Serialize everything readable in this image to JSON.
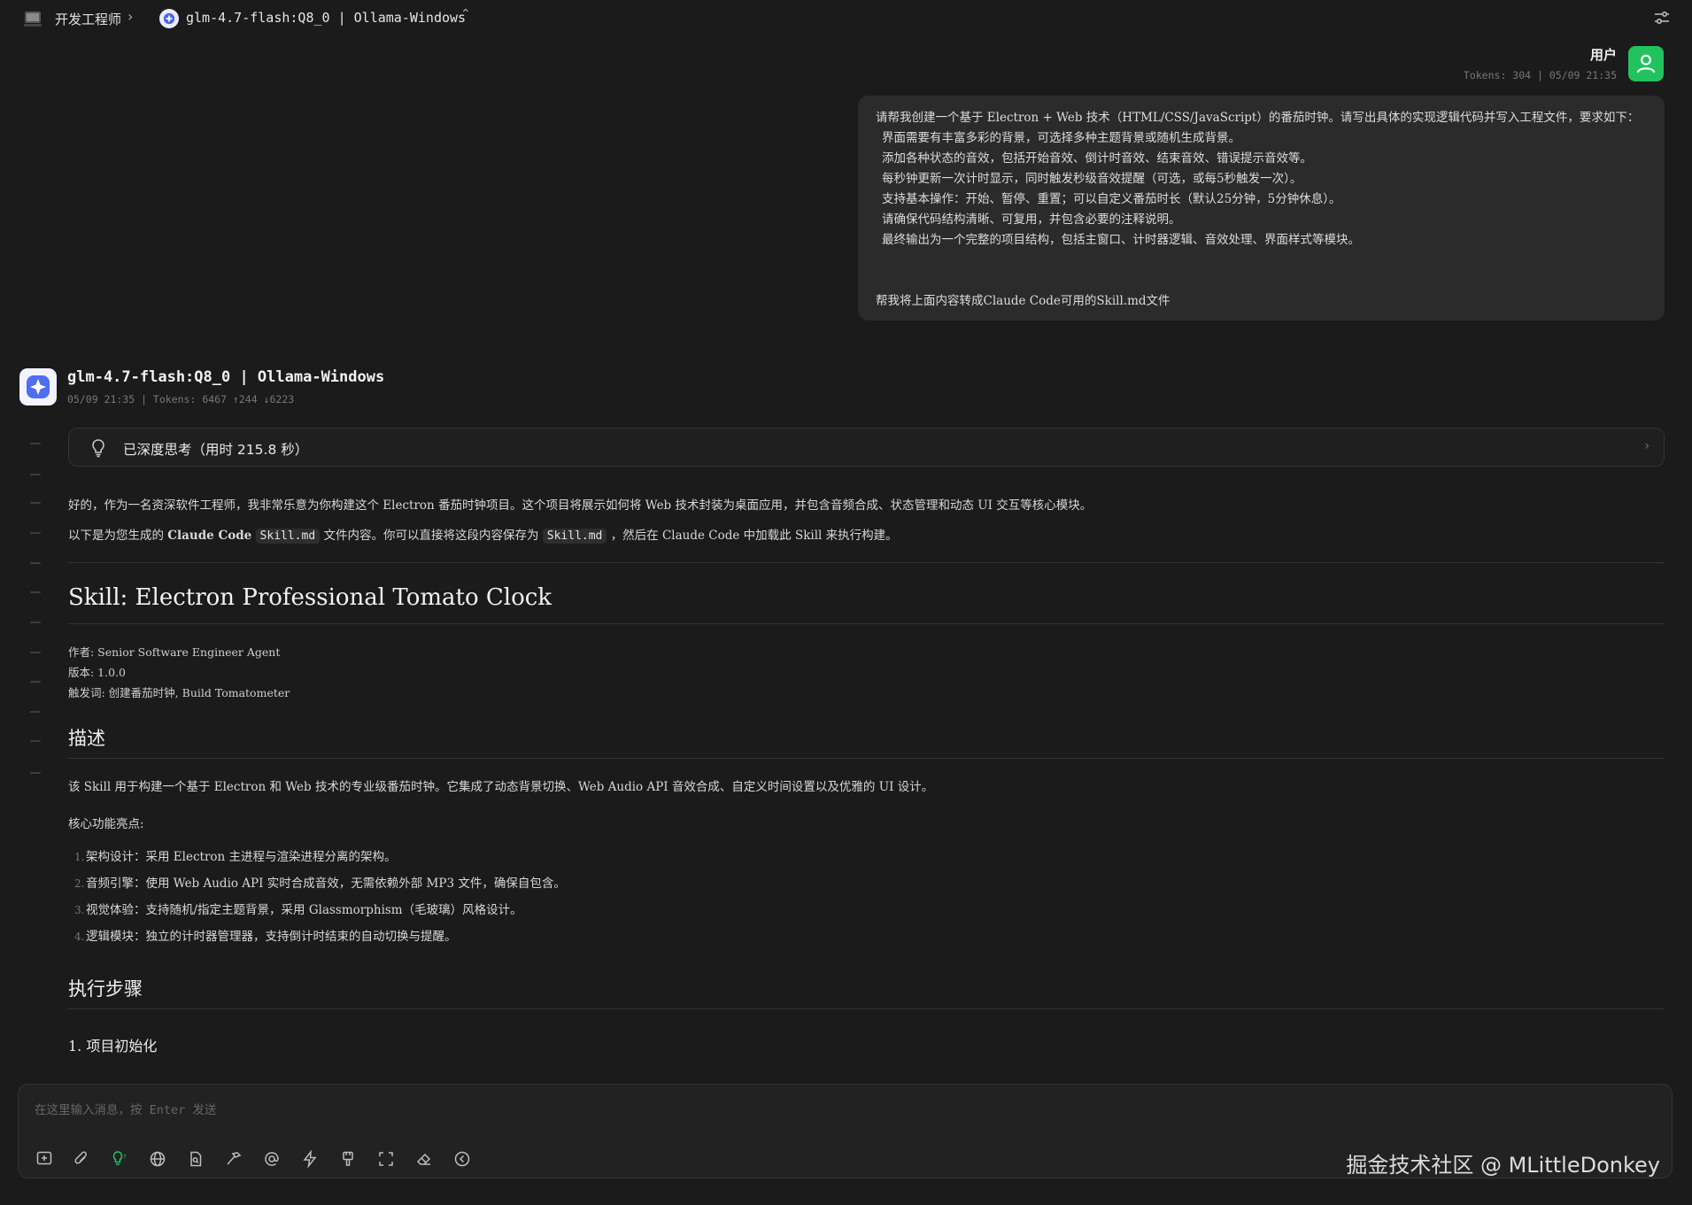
{
  "topbar": {
    "workspace": "开发工程师",
    "model": "glm-4.7-flash:Q8_0 | Ollama-Windows"
  },
  "user_message": {
    "name": "用户",
    "meta": "Tokens: 304 | 05/09 21:35",
    "lines": [
      "请帮我创建一个基于 Electron + Web 技术（HTML/CSS/JavaScript）的番茄时钟。请写出具体的实现逻辑代码并写入工程文件，要求如下：",
      "界面需要有丰富多彩的背景，可选择多种主题背景或随机生成背景。",
      "添加各种状态的音效，包括开始音效、倒计时音效、结束音效、错误提示音效等。",
      "每秒钟更新一次计时显示，同时触发秒级音效提醒（可选，或每5秒触发一次）。",
      "支持基本操作：开始、暂停、重置；可以自定义番茄时长（默认25分钟，5分钟休息）。",
      "请确保代码结构清晰、可复用，并包含必要的注释说明。",
      "最终输出为一个完整的项目结构，包括主窗口、计时器逻辑、音效处理、界面样式等模块。"
    ],
    "last_line": "帮我将上面内容转成Claude Code可用的Skill.md文件"
  },
  "assistant": {
    "name": "glm-4.7-flash:Q8_0 | Ollama-Windows",
    "meta": "05/09 21:35 | Tokens: 6467 ↑244 ↓6223",
    "thinking": "已深度思考（用时 215.8 秒）",
    "intro": "好的，作为一名资深软件工程师，我非常乐意为你构建这个 Electron 番茄时钟项目。这个项目将展示如何将 Web 技术封装为桌面应用，并包含音频合成、状态管理和动态 UI 交互等核心模块。",
    "line2_a": "以下是为您生成的",
    "line2_b": "Claude Code",
    "line2_code1": "Skill.md",
    "line2_c": "文件内容。你可以直接将这段内容保存为",
    "line2_code2": "Skill.md",
    "line2_d": "，然后在 Claude Code 中加载此 Skill 来执行构建。",
    "h1": "Skill: Electron Professional Tomato Clock",
    "author": "作者: Senior Software Engineer Agent",
    "version": "版本: 1.0.0",
    "trigger": "触发词: 创建番茄时钟, Build Tomatometer",
    "h2_desc": "描述",
    "desc": "该 Skill 用于构建一个基于 Electron 和 Web 技术的专业级番茄时钟。它集成了动态背景切换、Web Audio API 音效合成、自定义时间设置以及优雅的 UI 设计。",
    "features_title": "核心功能亮点:",
    "features": [
      {
        "num": "1.",
        "text": "架构设计：采用 Electron 主进程与渲染进程分离的架构。"
      },
      {
        "num": "2.",
        "text": "音频引擎：使用 Web Audio API 实时合成音效，无需依赖外部 MP3 文件，确保自包含。"
      },
      {
        "num": "3.",
        "text": "视觉体验：支持随机/指定主题背景，采用 Glassmorphism（毛玻璃）风格设计。"
      },
      {
        "num": "4.",
        "text": "逻辑模块：独立的计时器管理器，支持倒计时结束的自动切换与提醒。"
      }
    ],
    "h2_steps": "执行步骤",
    "h3_init": "1. 项目初始化"
  },
  "input": {
    "placeholder": "在这里输入消息，按 Enter 发送"
  },
  "watermark": "掘金技术社区 @ MLittleDonkey",
  "colors": {
    "background": "#1b1b1b",
    "bubble": "#2b2b2b",
    "user_avatar": "#22c35e",
    "accent_green": "#22c35e"
  }
}
